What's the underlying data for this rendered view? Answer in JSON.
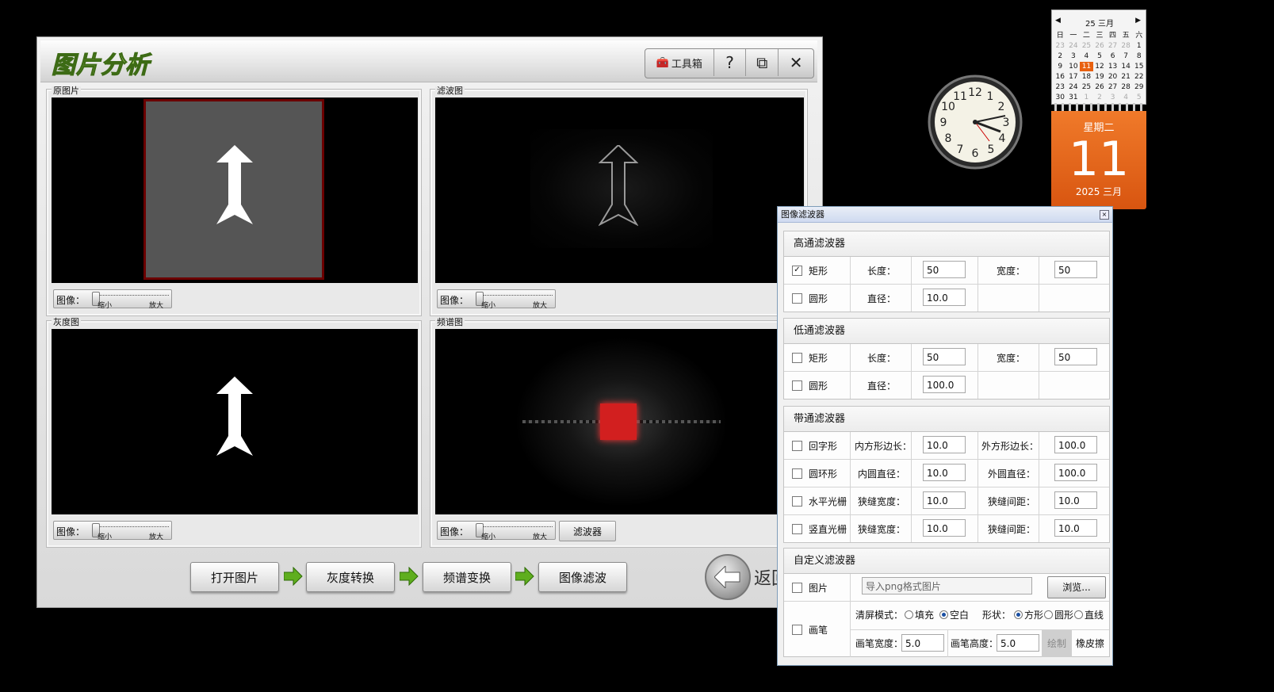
{
  "app": {
    "title": "图片分析",
    "toolbox_label": "工具箱",
    "help_label": "?",
    "restore_label": "⧉",
    "close_label": "✕"
  },
  "panels": {
    "original": {
      "label": "原图片"
    },
    "filtered": {
      "label": "滤波图"
    },
    "gray": {
      "label": "灰度图"
    },
    "spectrum": {
      "label": "频谱图"
    }
  },
  "slider": {
    "label": "图像：",
    "min_label": "缩小",
    "max_label": "放大"
  },
  "filter_button": "滤波器",
  "actions": {
    "open": "打开图片",
    "gray": "灰度转换",
    "spectrum": "频谱变换",
    "filter": "图像滤波",
    "back": "返回"
  },
  "calendar": {
    "header": "25 三月",
    "weekdays": [
      "日",
      "一",
      "二",
      "三",
      "四",
      "五",
      "六"
    ],
    "days": [
      [
        "23",
        "24",
        "25",
        "26",
        "27",
        "28",
        "1"
      ],
      [
        "2",
        "3",
        "4",
        "5",
        "6",
        "7",
        "8"
      ],
      [
        "9",
        "10",
        "11",
        "12",
        "13",
        "14",
        "15"
      ],
      [
        "16",
        "17",
        "18",
        "19",
        "20",
        "21",
        "22"
      ],
      [
        "23",
        "24",
        "25",
        "26",
        "27",
        "28",
        "29"
      ],
      [
        "30",
        "31",
        "1",
        "2",
        "3",
        "4",
        "5"
      ]
    ],
    "weekday_name": "星期二",
    "day": "11",
    "year_month": "2025 三月"
  },
  "dialog": {
    "title": "图像滤波器",
    "highpass": {
      "title": "高通滤波器",
      "rect_label": "矩形",
      "rect_checked": true,
      "length_label": "长度：",
      "length": "50",
      "width_label": "宽度：",
      "width": "50",
      "circle_label": "圆形",
      "diameter_label": "直径：",
      "diameter": "10.0"
    },
    "lowpass": {
      "title": "低通滤波器",
      "rect_label": "矩形",
      "length_label": "长度：",
      "length": "50",
      "width_label": "宽度：",
      "width": "50",
      "circle_label": "圆形",
      "diameter_label": "直径：",
      "diameter": "100.0"
    },
    "bandpass": {
      "title": "带通滤波器",
      "square_ring_label": "回字形",
      "inner_side_label": "内方形边长：",
      "inner_side": "10.0",
      "outer_side_label": "外方形边长：",
      "outer_side": "100.0",
      "ring_label": "圆环形",
      "inner_diam_label": "内圆直径：",
      "inner_diam": "10.0",
      "outer_diam_label": "外圆直径：",
      "outer_diam": "100.0",
      "hgrating_label": "水平光栅",
      "h_slit_width_label": "狭缝宽度：",
      "h_slit_width": "10.0",
      "h_slit_gap_label": "狭缝间距：",
      "h_slit_gap": "10.0",
      "vgrating_label": "竖直光栅",
      "v_slit_width_label": "狭缝宽度：",
      "v_slit_width": "10.0",
      "v_slit_gap_label": "狭缝间距：",
      "v_slit_gap": "10.0"
    },
    "custom": {
      "title": "自定义滤波器",
      "image_label": "图片",
      "import_placeholder": "导入png格式图片",
      "browse_label": "浏览...",
      "brush_label": "画笔",
      "clear_mode_label": "清屏模式：",
      "fill_label": "填充",
      "blank_label": "空白",
      "shape_label": "形状：",
      "square_label": "方形",
      "circle_label": "圆形",
      "line_label": "直线",
      "brush_width_label": "画笔宽度：",
      "brush_width": "5.0",
      "brush_height_label": "画笔高度：",
      "brush_height": "5.0",
      "draw_label": "绘制",
      "eraser_label": "橡皮擦"
    }
  }
}
